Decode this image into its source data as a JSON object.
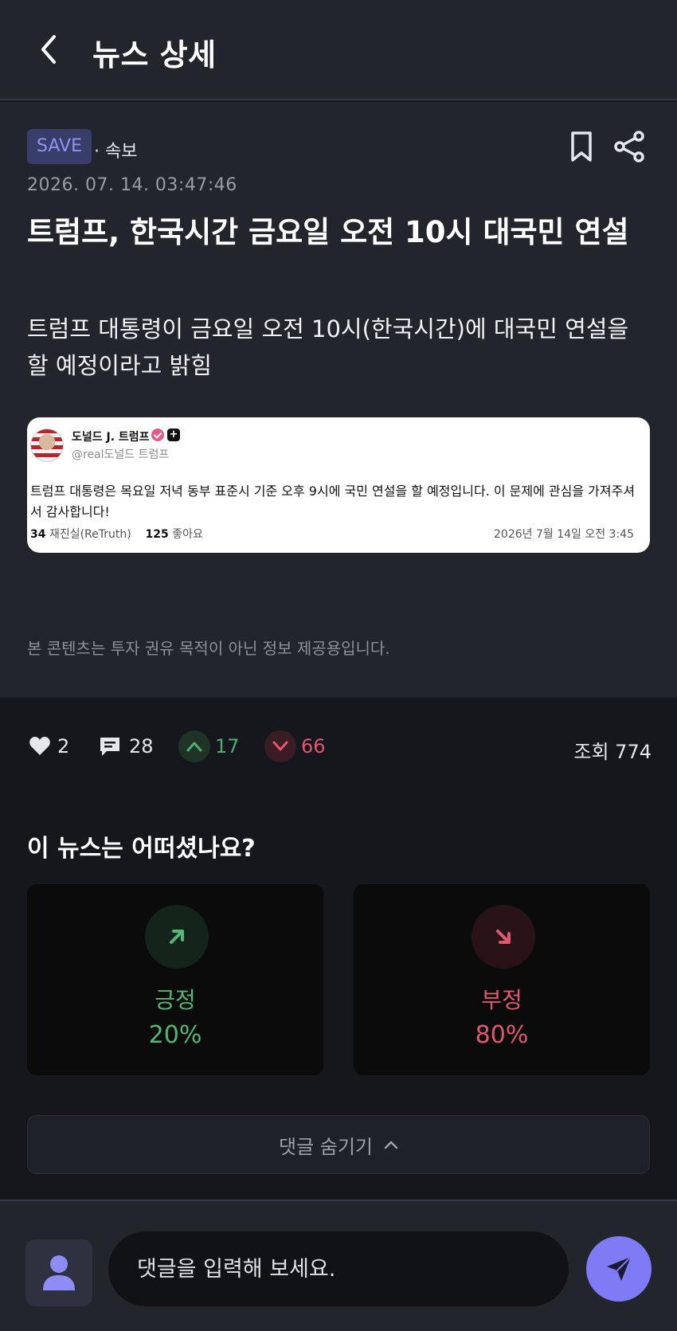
{
  "header": {
    "title": "뉴스 상세"
  },
  "article": {
    "tag": "SAVE",
    "category": "· 속보",
    "timestamp": "2026. 07. 14. 03:47:46",
    "headline": "트럼프, 한국시간 금요일 오전 10시 대국민 연설",
    "summary": "트럼프 대통령이 금요일 오전 10시(한국시간)에 대국민 연설을 할 예정이라고 밝힘",
    "post": {
      "author": "도널드 J. 트럼프",
      "plus_badge": "+",
      "handle": "@real도널드 트럼프",
      "body": "트럼프 대통령은 목요일 저녁 동부 표준시 기준 오후 9시에 국민 연설을 할 예정입니다. 이 문제에 관심을 가져주셔서 감사합니다!",
      "retruths_count": "34",
      "retruths_label": "재진실(ReTruth)",
      "likes_count": "125",
      "likes_label": "좋아요",
      "date": "2026년 7월 14일 오전 3:45"
    },
    "disclaimer": "본 콘텐츠는 투자 권유 목적이 아닌 정보 제공용입니다."
  },
  "stats": {
    "likes": "2",
    "comments": "28",
    "upvotes": "17",
    "downvotes": "66",
    "views": "조회 774"
  },
  "poll": {
    "title": "이 뉴스는 어떠셨나요?",
    "positive": {
      "label": "긍정",
      "percent": "20%"
    },
    "negative": {
      "label": "부정",
      "percent": "80%"
    }
  },
  "comments_toggle": {
    "label": "댓글 숨기기"
  },
  "input": {
    "placeholder": "댓글을 입력해 보세요."
  },
  "colors": {
    "accent": "#7f7bf5",
    "positive": "#52b778",
    "negative": "#e2566f",
    "tag_bg": "#393d6a"
  },
  "icons": [
    "back-icon",
    "bookmark-icon",
    "share-icon",
    "heart-icon",
    "comment-icon",
    "chevron-up-icon",
    "chevron-down-icon",
    "arrow-up-right-icon",
    "arrow-down-right-icon",
    "user-icon",
    "send-icon"
  ]
}
